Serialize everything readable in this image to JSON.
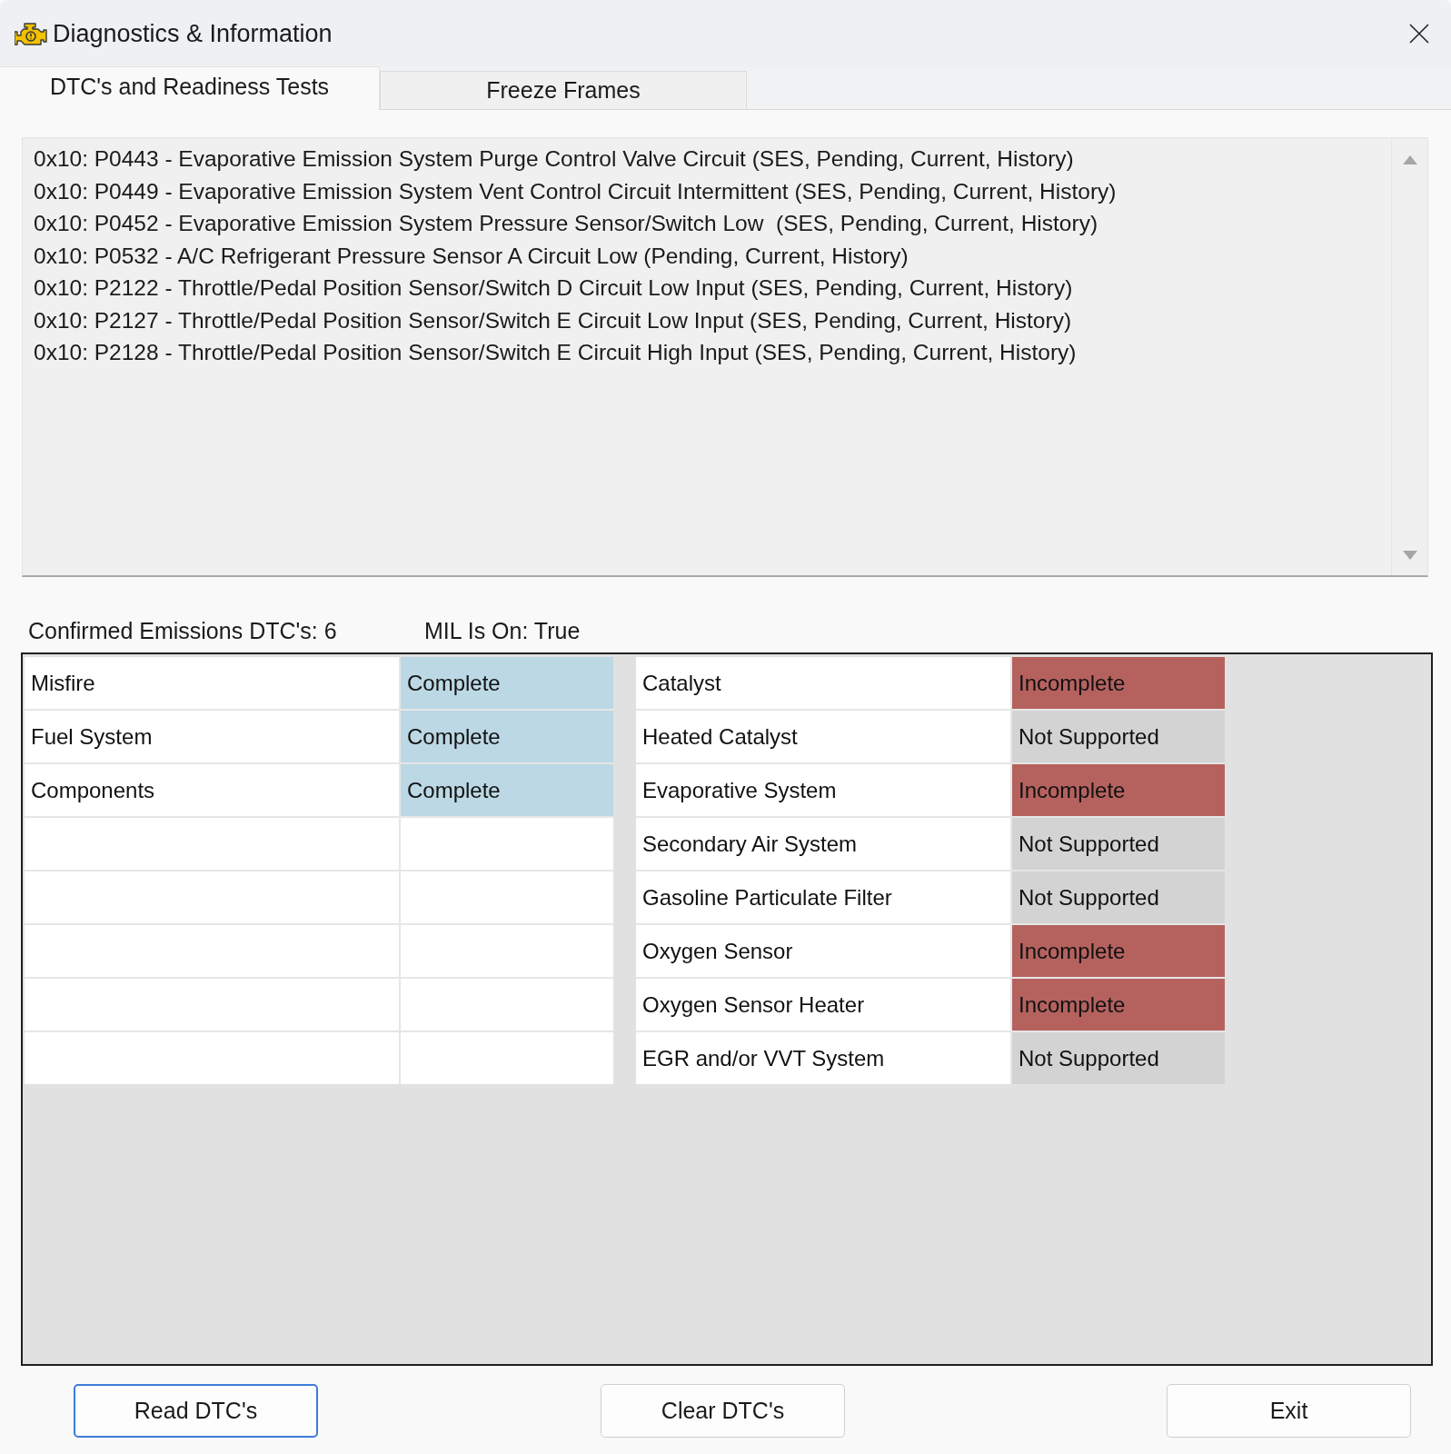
{
  "window": {
    "title": "Diagnostics & Information"
  },
  "tabs": [
    {
      "label": "DTC's and Readiness Tests",
      "selected": true
    },
    {
      "label": "Freeze Frames",
      "selected": false
    }
  ],
  "dtc_list": {
    "items": [
      "0x10: P0443 - Evaporative Emission System Purge Control Valve Circuit (SES, Pending, Current, History)",
      "0x10: P0449 - Evaporative Emission System Vent Control Circuit Intermittent (SES, Pending, Current, History)",
      "0x10: P0452 - Evaporative Emission System Pressure Sensor/Switch Low  (SES, Pending, Current, History)",
      "0x10: P0532 - A/C Refrigerant Pressure Sensor A Circuit Low (Pending, Current, History)",
      "0x10: P2122 - Throttle/Pedal Position Sensor/Switch D Circuit Low Input (SES, Pending, Current, History)",
      "0x10: P2127 - Throttle/Pedal Position Sensor/Switch E Circuit Low Input (SES, Pending, Current, History)",
      "0x10: P2128 - Throttle/Pedal Position Sensor/Switch E Circuit High Input (SES, Pending, Current, History)"
    ]
  },
  "summary": {
    "confirmed_dtcs": "Confirmed Emissions DTC's: 6",
    "mil_status": "MIL Is On: True"
  },
  "readiness": {
    "left": [
      {
        "test": "Misfire",
        "status": "Complete",
        "color": "#bcd8e4"
      },
      {
        "test": "Fuel System",
        "status": "Complete",
        "color": "#bcd8e4"
      },
      {
        "test": "Components",
        "status": "Complete",
        "color": "#bcd8e4"
      }
    ],
    "right": [
      {
        "test": "Catalyst",
        "status": "Incomplete",
        "color": "#b5625f"
      },
      {
        "test": "Heated Catalyst",
        "status": "Not Supported",
        "color": "#d3d3d3"
      },
      {
        "test": "Evaporative System",
        "status": "Incomplete",
        "color": "#b5625f"
      },
      {
        "test": "Secondary Air System",
        "status": "Not Supported",
        "color": "#d3d3d3"
      },
      {
        "test": "Gasoline Particulate Filter",
        "status": "Not Supported",
        "color": "#d3d3d3"
      },
      {
        "test": "Oxygen Sensor",
        "status": "Incomplete",
        "color": "#b5625f"
      },
      {
        "test": "Oxygen Sensor Heater",
        "status": "Incomplete",
        "color": "#b5625f"
      },
      {
        "test": "EGR and/or VVT System",
        "status": "Not Supported",
        "color": "#d3d3d3"
      }
    ]
  },
  "buttons": [
    {
      "label": "Read DTC's",
      "focused": true
    },
    {
      "label": "Clear DTC's",
      "focused": false
    },
    {
      "label": "Exit",
      "focused": false
    }
  ]
}
